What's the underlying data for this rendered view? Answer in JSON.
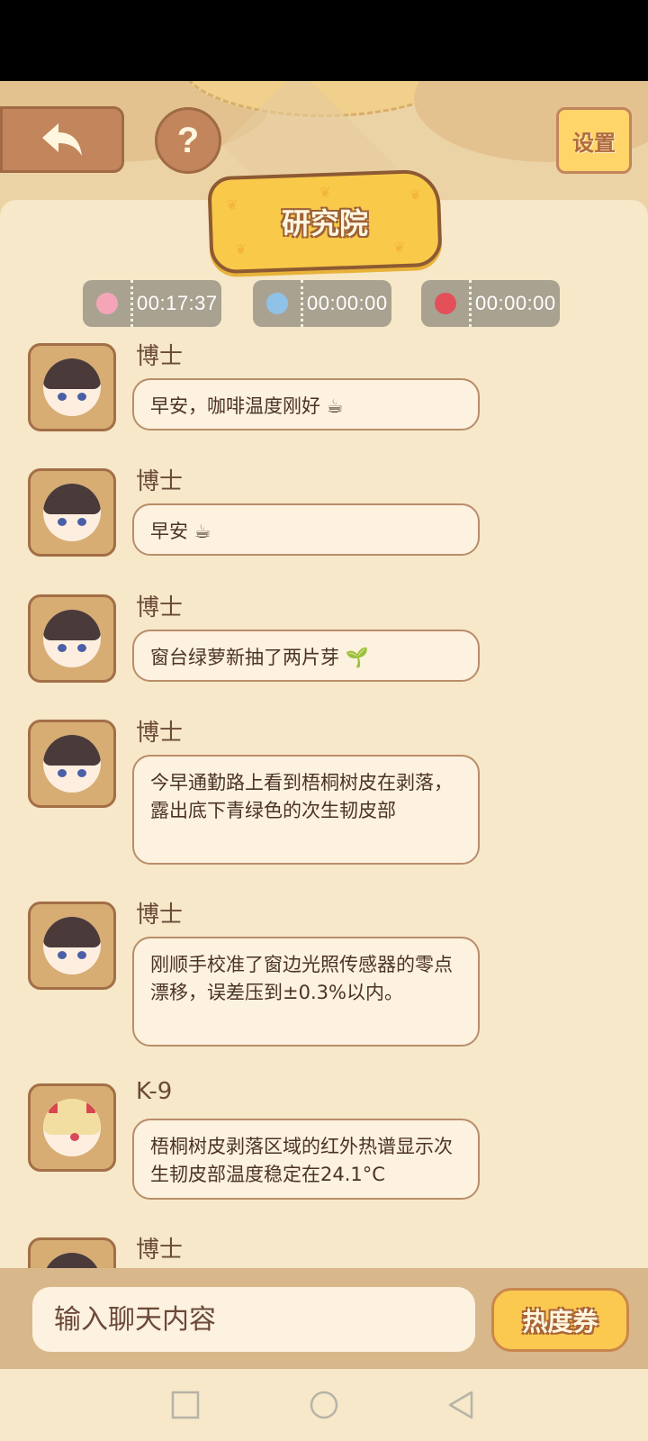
{
  "header": {
    "settings_label": "设置",
    "help_label": "?",
    "title": "研究院"
  },
  "timers": [
    {
      "icon": "pink-character-icon",
      "time": "00:17:37",
      "color": "#f4a6b8"
    },
    {
      "icon": "blue-character-icon",
      "time": "00:00:00",
      "color": "#8fc2e6"
    },
    {
      "icon": "red-character-icon",
      "time": "00:00:00",
      "color": "#e3505a"
    }
  ],
  "messages": [
    {
      "sender": "博士",
      "text": "早安，咖啡温度刚好 ☕"
    },
    {
      "sender": "博士",
      "text": "早安 ☕"
    },
    {
      "sender": "博士",
      "text": "窗台绿萝新抽了两片芽 🌱"
    },
    {
      "sender": "博士",
      "text": "今早通勤路上看到梧桐树皮在剥落，露出底下青绿色的次生韧皮部"
    },
    {
      "sender": "博士",
      "text": "刚顺手校准了窗边光照传感器的零点漂移，误差压到±0.3%以内。"
    },
    {
      "sender": "K-9",
      "text": "梧桐树皮剥落区域的红外热谱显示次生韧皮部温度稳定在24.1°C"
    },
    {
      "sender": "博士",
      "text": ""
    }
  ],
  "input": {
    "placeholder": "输入聊天内容",
    "coupon_label": "热度券"
  },
  "colors": {
    "background": "#f6e8c8",
    "accent": "#f9c94a",
    "button_brown": "#c2855c"
  }
}
